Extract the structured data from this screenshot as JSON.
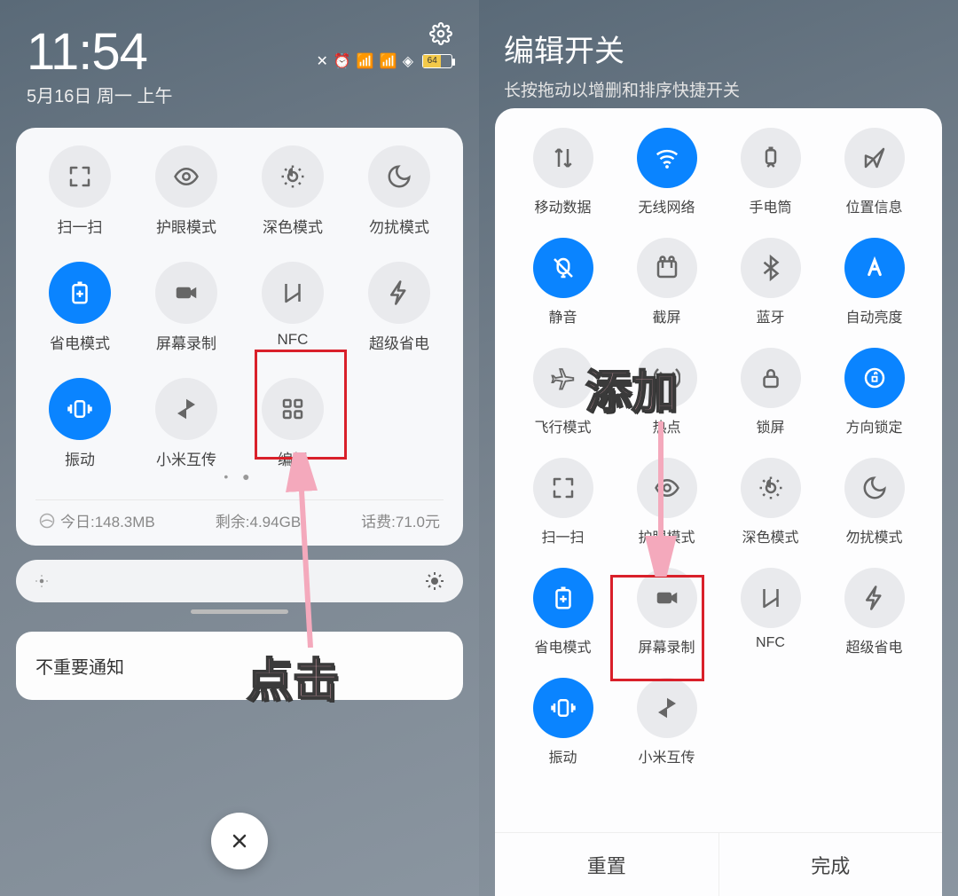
{
  "left": {
    "time": "11:54",
    "date": "5月16日 周一 上午",
    "battery_text": "64",
    "tiles": [
      {
        "label": "扫一扫",
        "icon": "scan",
        "on": false
      },
      {
        "label": "护眼模式",
        "icon": "eye",
        "on": false
      },
      {
        "label": "深色模式",
        "icon": "darksun",
        "on": false
      },
      {
        "label": "勿扰模式",
        "icon": "moon",
        "on": false
      },
      {
        "label": "省电模式",
        "icon": "battery",
        "on": true
      },
      {
        "label": "屏幕录制",
        "icon": "video",
        "on": false
      },
      {
        "label": "NFC",
        "icon": "nfc",
        "on": false
      },
      {
        "label": "超级省电",
        "icon": "bolt",
        "on": false
      },
      {
        "label": "振动",
        "icon": "vibrate",
        "on": true
      },
      {
        "label": "小米互传",
        "icon": "share",
        "on": false
      },
      {
        "label": "编辑",
        "icon": "grid",
        "on": false
      }
    ],
    "data_today_label": "今日:148.3MB",
    "data_remain_label": "剩余:4.94GB",
    "phone_bill_label": "话费:71.0元",
    "notif_title": "不重要通知"
  },
  "right": {
    "title": "编辑开关",
    "subtitle": "长按拖动以增删和排序快捷开关",
    "tiles": [
      {
        "label": "移动数据",
        "icon": "data",
        "on": false
      },
      {
        "label": "无线网络",
        "icon": "wifi",
        "on": true
      },
      {
        "label": "手电筒",
        "icon": "flash",
        "on": false
      },
      {
        "label": "位置信息",
        "icon": "loc",
        "on": false
      },
      {
        "label": "静音",
        "icon": "mute",
        "on": true
      },
      {
        "label": "截屏",
        "icon": "screenshot",
        "on": false
      },
      {
        "label": "蓝牙",
        "icon": "bt",
        "on": false
      },
      {
        "label": "自动亮度",
        "icon": "autoA",
        "on": true
      },
      {
        "label": "飞行模式",
        "icon": "plane",
        "on": false
      },
      {
        "label": "热点",
        "icon": "hotspot",
        "on": false
      },
      {
        "label": "锁屏",
        "icon": "lock",
        "on": false
      },
      {
        "label": "方向锁定",
        "icon": "rotlock",
        "on": true
      },
      {
        "label": "扫一扫",
        "icon": "scan",
        "on": false
      },
      {
        "label": "护眼模式",
        "icon": "eye",
        "on": false
      },
      {
        "label": "深色模式",
        "icon": "darksun",
        "on": false
      },
      {
        "label": "勿扰模式",
        "icon": "moon",
        "on": false
      },
      {
        "label": "省电模式",
        "icon": "battery",
        "on": true
      },
      {
        "label": "屏幕录制",
        "icon": "video",
        "on": false
      },
      {
        "label": "NFC",
        "icon": "nfc",
        "on": false
      },
      {
        "label": "超级省电",
        "icon": "bolt",
        "on": false
      },
      {
        "label": "振动",
        "icon": "vibrate",
        "on": true
      },
      {
        "label": "小米互传",
        "icon": "share",
        "on": false
      }
    ],
    "reset_label": "重置",
    "done_label": "完成"
  },
  "annotations": {
    "click_label": "点击",
    "add_label": "添加"
  }
}
